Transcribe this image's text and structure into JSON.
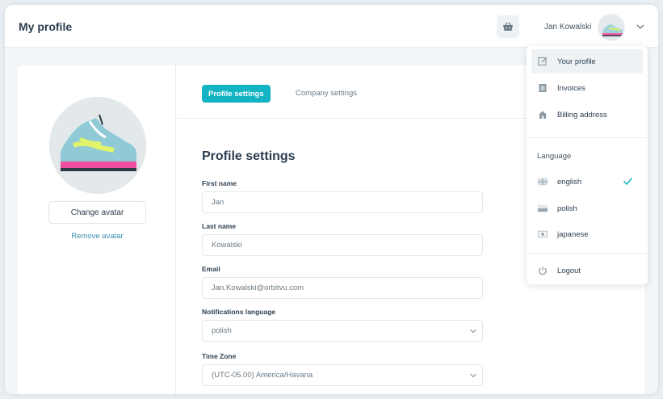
{
  "header": {
    "title": "My profile",
    "user_name": "Jan Kowalski",
    "cart_icon": "basket-icon"
  },
  "avatar": {
    "change_label": "Change avatar",
    "remove_label": "Remove avatar"
  },
  "tabs": [
    {
      "label": "Profile settings",
      "active": true
    },
    {
      "label": "Company settings",
      "active": false
    }
  ],
  "form": {
    "title": "Profile settings",
    "first_name": {
      "label": "First name",
      "value": "Jan"
    },
    "last_name": {
      "label": "Last name",
      "value": "Kowalski"
    },
    "email": {
      "label": "Email",
      "value": "Jan.Kowalski@orbitvu.com"
    },
    "notifications_language": {
      "label": "Notifications language",
      "value": "polish"
    },
    "time_zone": {
      "label": "Time Zone",
      "value": "(UTC-05.00) America/Havana"
    }
  },
  "menu": {
    "items": [
      {
        "label": "Your profile",
        "icon": "edit-icon"
      },
      {
        "label": "Invoices",
        "icon": "invoice-icon"
      },
      {
        "label": "Billing address",
        "icon": "home-icon"
      }
    ],
    "language_heading": "Language",
    "languages": [
      {
        "label": "english",
        "icon": "flag-uk-icon",
        "selected": true
      },
      {
        "label": "polish",
        "icon": "flag-pl-icon",
        "selected": false
      },
      {
        "label": "japanese",
        "icon": "flag-jp-icon",
        "selected": false
      }
    ],
    "logout_label": "Logout"
  },
  "colors": {
    "accent": "#12b3c3",
    "link": "#3d8fb0",
    "text": "#2c3e50"
  }
}
